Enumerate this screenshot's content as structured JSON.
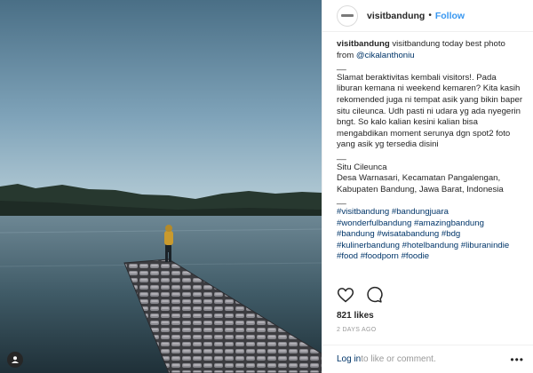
{
  "post": {
    "username": "visitbandung",
    "dot": "•",
    "follow_label": "Follow",
    "caption": {
      "username": "visitbandung",
      "line1": " visitbandung today best photo from ",
      "mention": "@cikalanthoniu",
      "sep1": "__",
      "p1": "Slamat beraktivitas kembali visitors!. Pada liburan kemana ni weekend kemaren? Kita kasih rekomended juga ni tempat asik yang bikin baper situ cileunca. Udh pasti ni udara yg ada nyegerin bngt. So kalo kalian kesini kalian bisa mengabdikan moment serunya dgn spot2 foto yang asik yg tersedia disini",
      "sep2": "__",
      "place_name": "Situ Cileunca",
      "address": "Desa Warnasari, Kecamatan Pangalengan, Kabupaten Bandung, Jawa Barat, Indonesia",
      "sep3": "__",
      "hashtags": [
        "#visitbandung",
        "#bandungjuara",
        "#wonderfulbandung",
        "#amazingbandung",
        "#bandung",
        "#wisatabandung",
        "#bdg",
        "#kulinerbandung",
        "#hotelbandung",
        "#liburanindie",
        "#food",
        "#foodporn",
        "#foodie"
      ]
    },
    "likes": "821 likes",
    "time": "2 DAYS AGO",
    "comment": {
      "login": "Log in",
      "rest": " to like or comment."
    },
    "more": "•••",
    "icons": {
      "like": "heart-icon",
      "comment": "comment-icon",
      "user_tag": "user-tag-icon",
      "more": "more-options-icon"
    },
    "colors": {
      "link": "#003569",
      "follow": "#3897f0",
      "meta": "#999999"
    }
  }
}
